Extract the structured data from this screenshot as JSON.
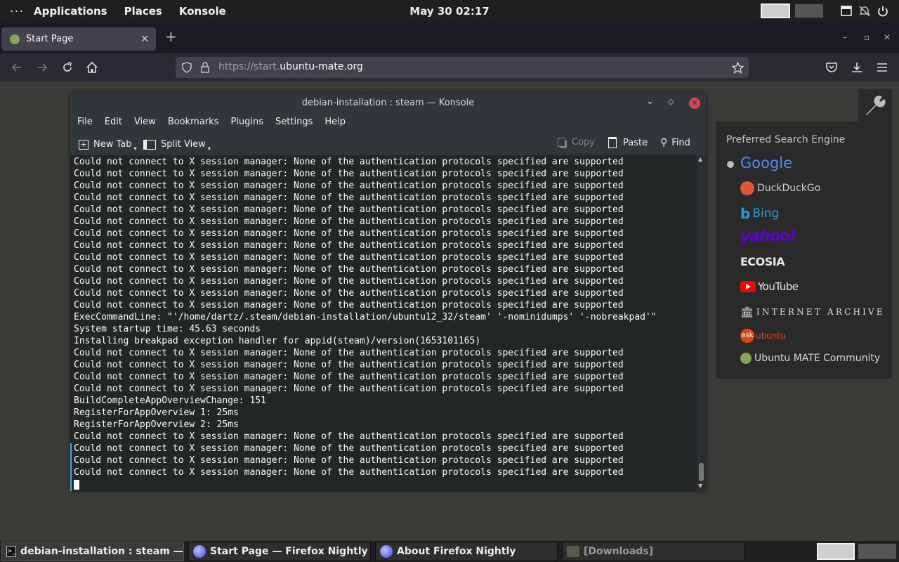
{
  "top_panel": {
    "menus": [
      "Applications",
      "Places",
      "Konsole"
    ],
    "clock": "May 30  02:17"
  },
  "browser": {
    "tab_title": "Start Page",
    "url_prefix": "https://start.",
    "url_host": "ubuntu-mate.org"
  },
  "search_panel": {
    "heading": "Preferred Search Engine",
    "engines": [
      "Google",
      "DuckDuckGo",
      "Bing",
      "yahoo!",
      "ECOSIA",
      "YouTube",
      "INTERNET ARCHIVE",
      "ubuntu",
      "Ubuntu MATE Community"
    ],
    "ask_badge": "ask",
    "selected": "Google"
  },
  "konsole": {
    "title": "debian-installation : steam — Konsole",
    "menu": [
      "File",
      "Edit",
      "View",
      "Bookmarks",
      "Plugins",
      "Settings",
      "Help"
    ],
    "toolbar": {
      "new_tab": "New Tab",
      "split_view": "Split View",
      "copy": "Copy",
      "paste": "Paste",
      "find": "Find"
    },
    "output": "Could not connect to X session manager: None of the authentication protocols specified are supported\nCould not connect to X session manager: None of the authentication protocols specified are supported\nCould not connect to X session manager: None of the authentication protocols specified are supported\nCould not connect to X session manager: None of the authentication protocols specified are supported\nCould not connect to X session manager: None of the authentication protocols specified are supported\nCould not connect to X session manager: None of the authentication protocols specified are supported\nCould not connect to X session manager: None of the authentication protocols specified are supported\nCould not connect to X session manager: None of the authentication protocols specified are supported\nCould not connect to X session manager: None of the authentication protocols specified are supported\nCould not connect to X session manager: None of the authentication protocols specified are supported\nCould not connect to X session manager: None of the authentication protocols specified are supported\nCould not connect to X session manager: None of the authentication protocols specified are supported\nCould not connect to X session manager: None of the authentication protocols specified are supported\nExecCommandLine: \"'/home/dartz/.steam/debian-installation/ubuntu12_32/steam' '-nominidumps' '-nobreakpad'\"\nSystem startup time: 45.63 seconds\nInstalling breakpad exception handler for appid(steam)/version(1653101165)\nCould not connect to X session manager: None of the authentication protocols specified are supported\nCould not connect to X session manager: None of the authentication protocols specified are supported\nCould not connect to X session manager: None of the authentication protocols specified are supported\nCould not connect to X session manager: None of the authentication protocols specified are supported\nBuildCompleteAppOverviewChange: 151\nRegisterForAppOverview 1: 25ms\nRegisterForAppOverview 2: 25ms\nCould not connect to X session manager: None of the authentication protocols specified are supported\nCould not connect to X session manager: None of the authentication protocols specified are supported\nCould not connect to X session manager: None of the authentication protocols specified are supported\nCould not connect to X session manager: None of the authentication protocols specified are supported"
  },
  "taskbar": [
    "debian-installation : steam — K...",
    "Start Page — Firefox Nightly",
    "About Firefox Nightly",
    "[Downloads]"
  ],
  "colors": {
    "panel": "#1f1f1f",
    "desktop": "#3b3b38",
    "konsole_bg": "#31363b",
    "terminal_bg": "#232627",
    "close_button": "#da4453"
  }
}
